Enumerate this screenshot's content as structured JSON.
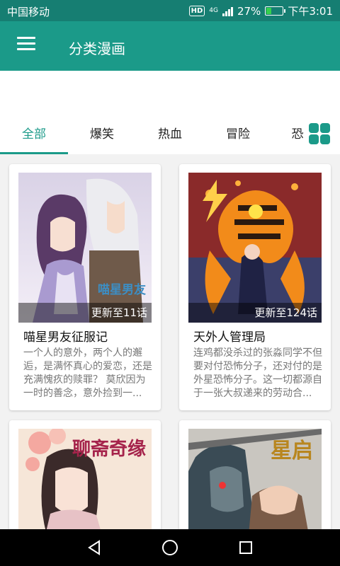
{
  "status_bar": {
    "carrier": "中国移动",
    "hd_badge": "HD",
    "network": "4G",
    "battery": "27%",
    "battery_level": 0.27,
    "time": "下午3:01"
  },
  "app_bar": {
    "menu_icon": "hamburger-menu-icon",
    "title": "分类漫画"
  },
  "tabs": [
    {
      "label": "全部",
      "active": true
    },
    {
      "label": "爆笑",
      "active": false
    },
    {
      "label": "热血",
      "active": false
    },
    {
      "label": "冒险",
      "active": false
    },
    {
      "label": "恐",
      "active": false
    }
  ],
  "grid_icon": "grid-view-icon",
  "comics": [
    {
      "title": "喵星男友征服记",
      "update": "更新至11话",
      "cover_text": "喵星男友",
      "description": "一个人的意外，两个人的邂逅，是满怀真心的爱恋，还是充满愧疚的赎罪？ 莫欣因为一时的善念，意外捡到一..."
    },
    {
      "title": "天外人管理局",
      "update": "更新至124话",
      "cover_text": "",
      "description": "连鸡都没杀过的张淼同学不但要对付恐怖分子，还对付的是外星恐怖分子。这一切都源自于一张大叔递来的劳动合..."
    },
    {
      "title": "",
      "update": "",
      "cover_text": "聊斋奇缘",
      "description": ""
    },
    {
      "title": "",
      "update": "",
      "cover_text": "星启",
      "description": ""
    }
  ],
  "nav_bar": {
    "back_icon": "back-triangle-icon",
    "home_icon": "home-circle-icon",
    "recents_icon": "recents-square-icon"
  },
  "colors": {
    "status_bar": "#167e72",
    "app_bar": "#1b9a89",
    "accent": "#1b9a89",
    "nav_bar": "#000000"
  }
}
